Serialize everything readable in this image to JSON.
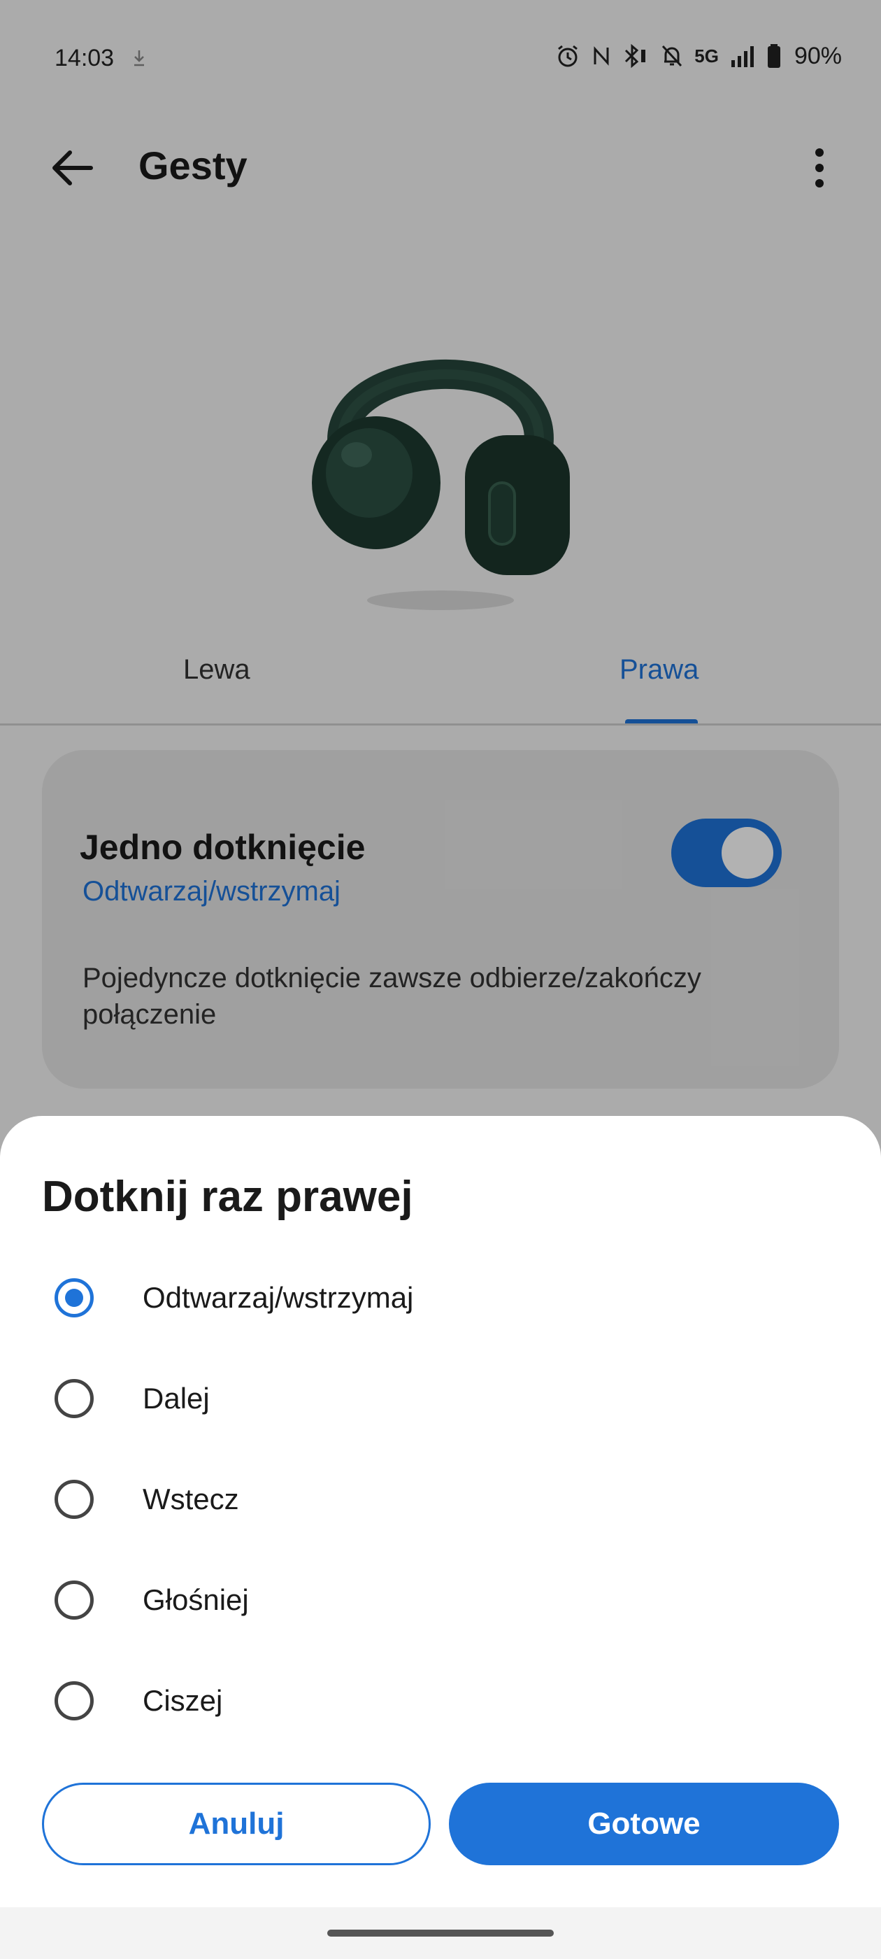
{
  "status_bar": {
    "time": "14:03",
    "network": "5G",
    "battery": "90%",
    "icons": [
      "download-icon",
      "alarm-icon",
      "nfc-icon",
      "bluetooth-icon",
      "mute-icon",
      "signal-icon",
      "battery-icon"
    ]
  },
  "app_bar": {
    "title": "Gesty",
    "back_icon": "back-arrow-icon",
    "menu_icon": "more-vert-icon"
  },
  "tabs": [
    {
      "label": "Lewa",
      "selected": false
    },
    {
      "label": "Prawa",
      "selected": true
    }
  ],
  "card": {
    "title": "Jedno dotknięcie",
    "subtitle": "Odtwarzaj/wstrzymaj",
    "toggle_on": true,
    "description": "Pojedyncze dotknięcie zawsze odbierze/zakończy połączenie"
  },
  "sheet": {
    "title": "Dotknij raz prawej",
    "options": [
      {
        "label": "Odtwarzaj/wstrzymaj",
        "selected": true
      },
      {
        "label": "Dalej",
        "selected": false
      },
      {
        "label": "Wstecz",
        "selected": false
      },
      {
        "label": "Głośniej",
        "selected": false
      },
      {
        "label": "Ciszej",
        "selected": false
      }
    ],
    "cancel_label": "Anuluj",
    "done_label": "Gotowe"
  },
  "colors": {
    "accent": "#1f73d8",
    "scrim": "rgba(0,0,0,0.30)",
    "headphones": "#1f3d33"
  }
}
